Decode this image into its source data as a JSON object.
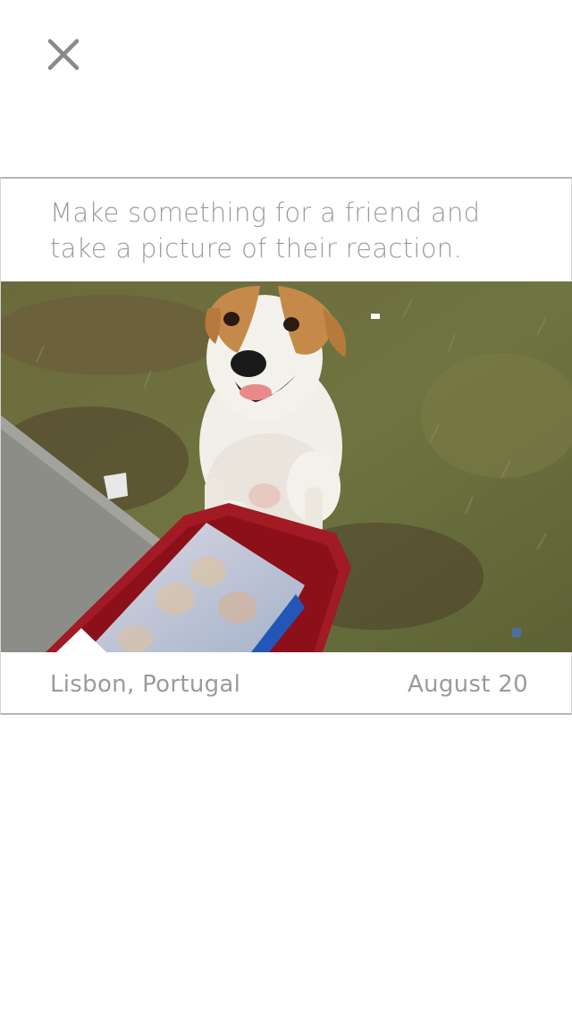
{
  "header": {
    "close_icon": "close-icon"
  },
  "card": {
    "prompt": "Make something for a friend and take a picture of their reaction.",
    "photo": {
      "subject": "dog-photo"
    },
    "location": "Lisbon, Portugal",
    "date": "August 20"
  },
  "colors": {
    "text": "#9b9b9b",
    "icon": "#8a8a8a",
    "border": "#b5b5b5",
    "background": "#ffffff"
  }
}
